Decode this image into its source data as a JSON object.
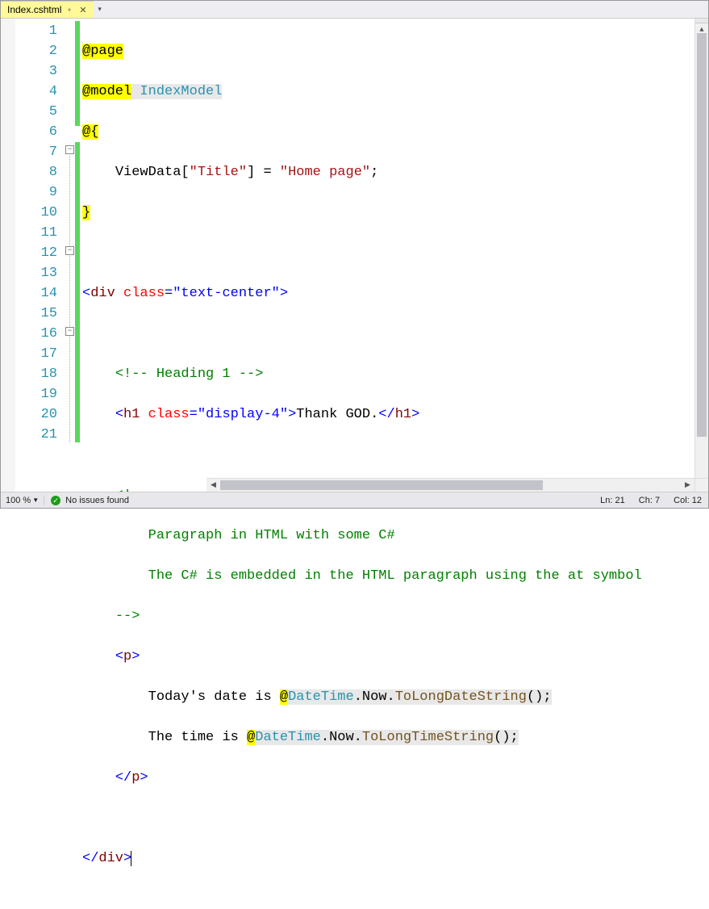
{
  "tab": {
    "filename": "Index.cshtml"
  },
  "lines": {
    "count": 21,
    "l1": {
      "page": "@page"
    },
    "l2": {
      "model": "@model",
      "type": " IndexModel"
    },
    "l3": {
      "open": "@{"
    },
    "l4": {
      "viewdata": "ViewData[",
      "titlekey": "\"Title\"",
      "eq": "] = ",
      "val": "\"Home page\"",
      "semi": ";"
    },
    "l5": {
      "close": "}"
    },
    "l7": {
      "lt": "<",
      "tag": "div",
      "sp": " ",
      "attr": "class",
      "eq": "=",
      "val": "\"text-center\"",
      "gt": ">"
    },
    "l9": {
      "c": "<!-- Heading 1 -->"
    },
    "l10": {
      "lt": "<",
      "tag": "h1",
      "sp": " ",
      "attr": "class",
      "eq": "=",
      "val": "\"display-4\"",
      "gt": ">",
      "txt": "Thank GOD.",
      "ct": "</",
      "ctag": "h1",
      "cgt": ">"
    },
    "l12": {
      "c": "<!--"
    },
    "l13": {
      "c": "    Paragraph in HTML with some C#"
    },
    "l14": {
      "c": "    The C# is embedded in the HTML paragraph using the at symbol"
    },
    "l15": {
      "c": "-->"
    },
    "l16": {
      "lt": "<",
      "tag": "p",
      "gt": ">"
    },
    "l17": {
      "txt1": "Today's date is ",
      "at": "@",
      "dt": "DateTime",
      "now": ".Now.",
      "m": "ToLongDateString",
      "p": "();"
    },
    "l18": {
      "txt1": "The time is ",
      "at": "@",
      "dt": "DateTime",
      "now": ".Now.",
      "m": "ToLongTimeString",
      "p": "();"
    },
    "l19": {
      "ct": "</",
      "tag": "p",
      "gt": ">"
    },
    "l21": {
      "ct": "</",
      "tag": "div",
      "gt": ">"
    }
  },
  "status": {
    "zoom": "100 %",
    "issues": "No issues found",
    "ln": "Ln: 21",
    "ch": "Ch: 7",
    "col": "Col: 12"
  }
}
